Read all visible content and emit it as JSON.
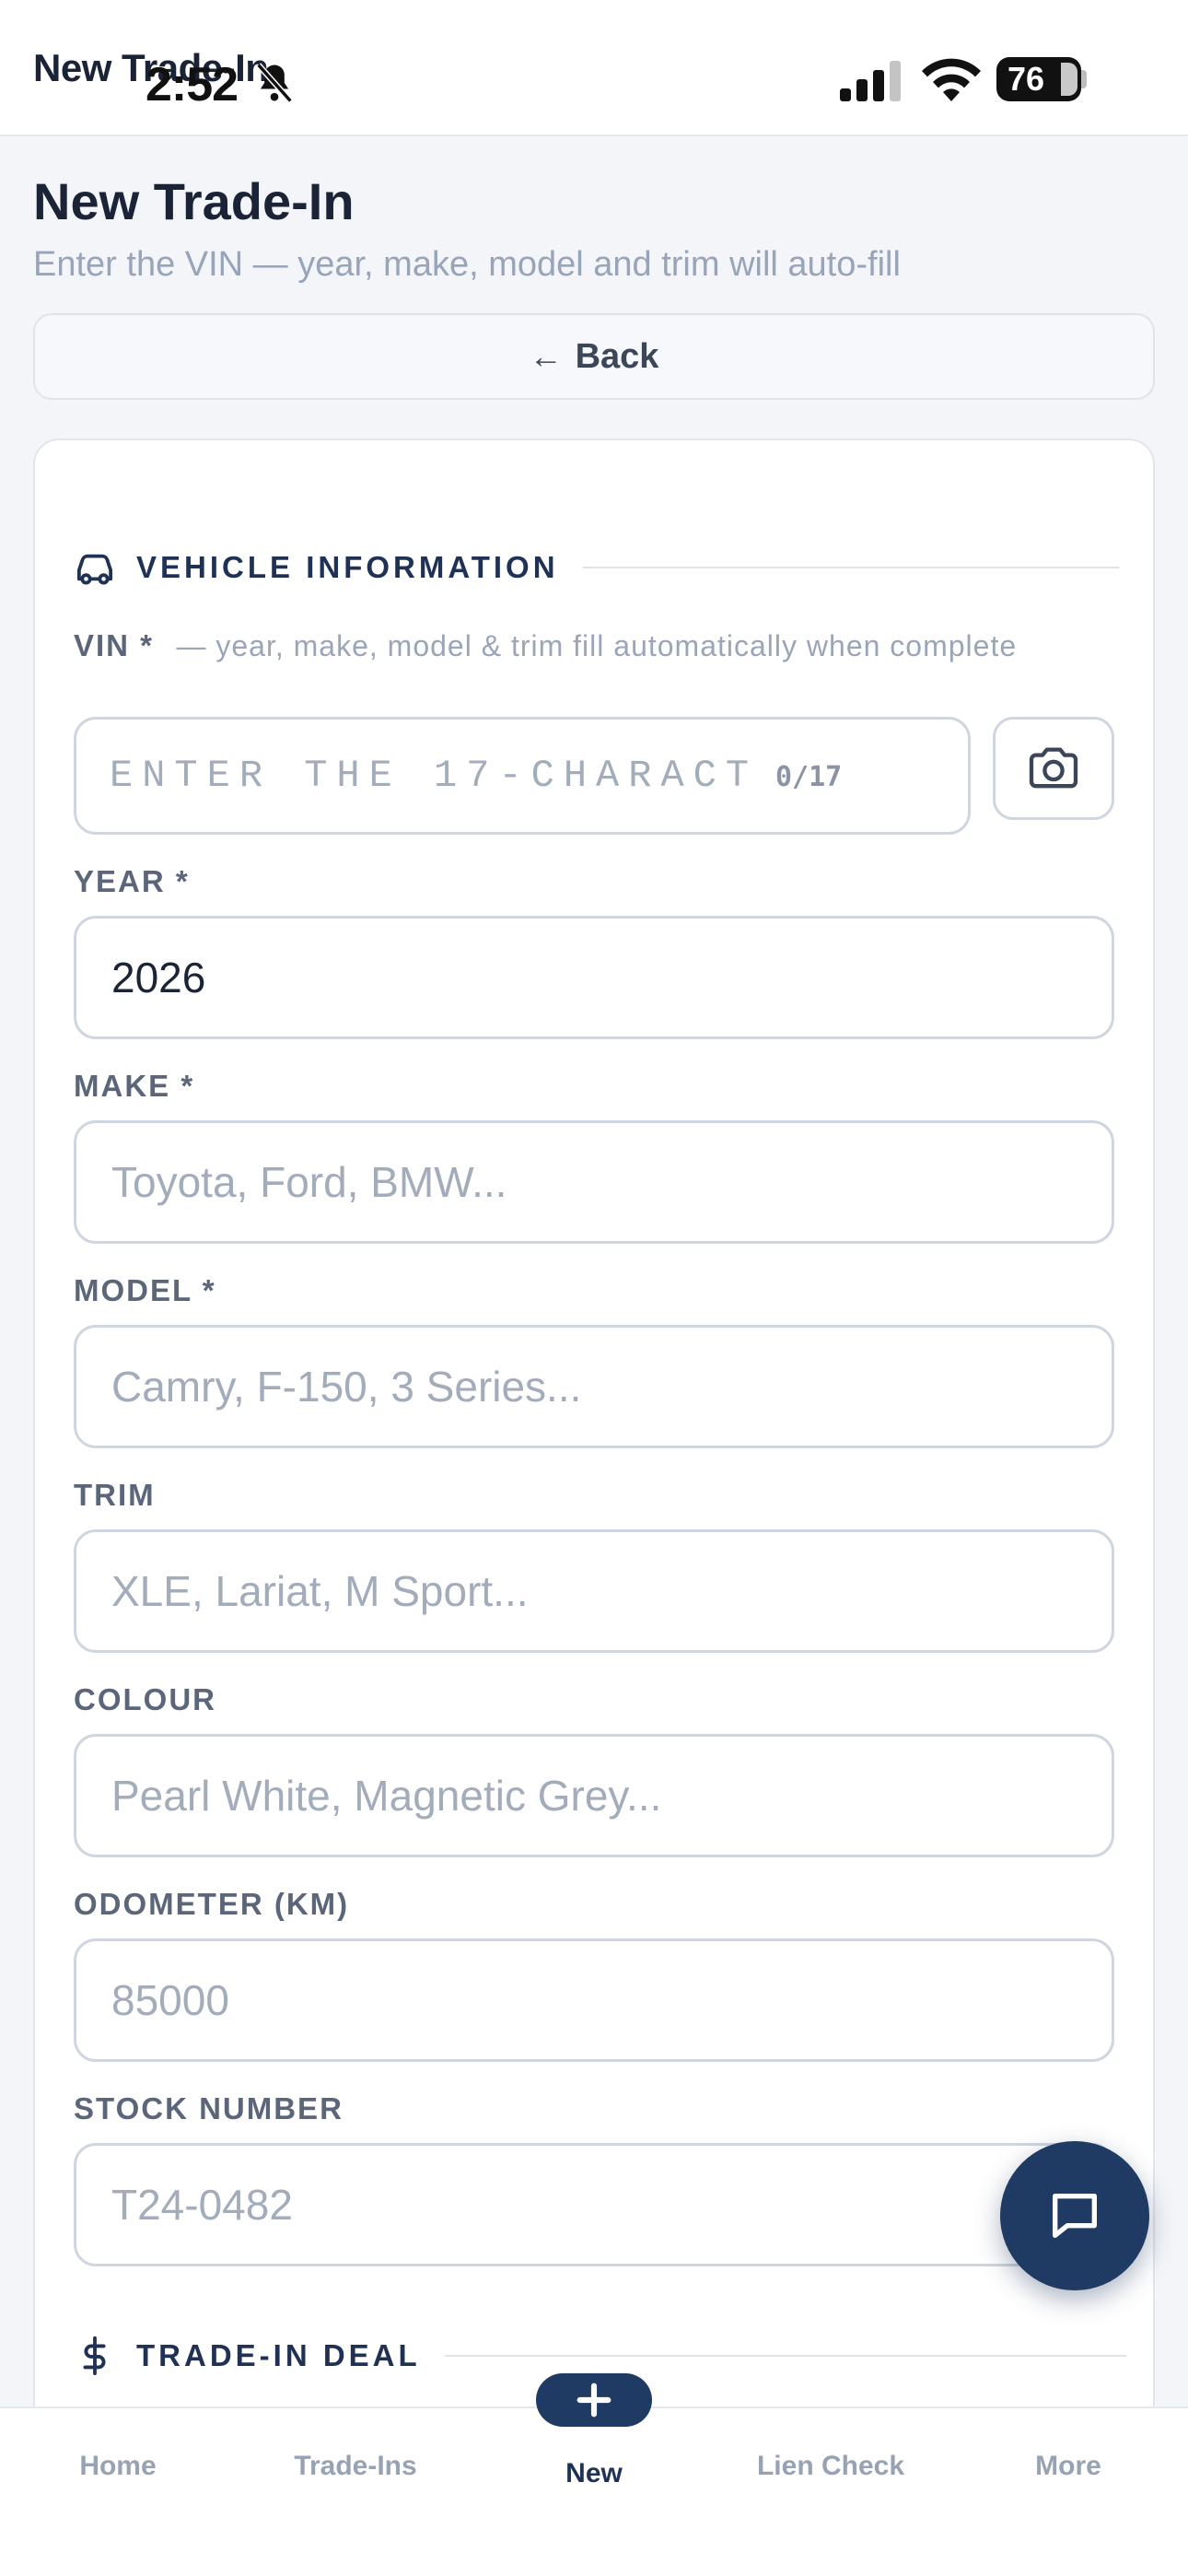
{
  "status_bar": {
    "app_title": "New Trade-In",
    "time": "2:52",
    "battery": "76"
  },
  "header": {
    "title": "New Trade-In",
    "subtitle": "Enter the VIN — year, make, model and trim will auto-fill",
    "back_label": "Back",
    "back_arrow": "←"
  },
  "sections": {
    "vehicle": "VEHICLE INFORMATION",
    "deal": "TRADE-IN DEAL"
  },
  "vin": {
    "label": "VIN *",
    "hint": "— year, make, model & trim fill automatically when complete",
    "placeholder": "ENTER THE 17-CHARACT",
    "count": "0/17"
  },
  "fields": {
    "year": {
      "label": "YEAR *",
      "value": "2026"
    },
    "make": {
      "label": "MAKE *",
      "placeholder": "Toyota, Ford, BMW..."
    },
    "model": {
      "label": "MODEL *",
      "placeholder": "Camry, F-150, 3 Series..."
    },
    "trim": {
      "label": "TRIM",
      "placeholder": "XLE, Lariat, M Sport..."
    },
    "colour": {
      "label": "COLOUR",
      "placeholder": "Pearl White, Magnetic Grey..."
    },
    "odometer": {
      "label": "ODOMETER (KM)",
      "placeholder": "85000"
    },
    "stock": {
      "label": "STOCK NUMBER",
      "placeholder": "T24-0482"
    }
  },
  "nav": {
    "home": "Home",
    "trade_ins": "Trade-Ins",
    "new": "New",
    "lien_check": "Lien Check",
    "more": "More"
  },
  "colors": {
    "accent": "#1f3a63",
    "section_title": "#1f3155",
    "muted": "#98a4b8"
  },
  "icons": {
    "vehicle_section": "car-icon",
    "deal_section": "dollar-icon",
    "vin_scan": "camera-icon",
    "fab": "chat-bubble-icon",
    "new_tab": "plus-icon"
  }
}
